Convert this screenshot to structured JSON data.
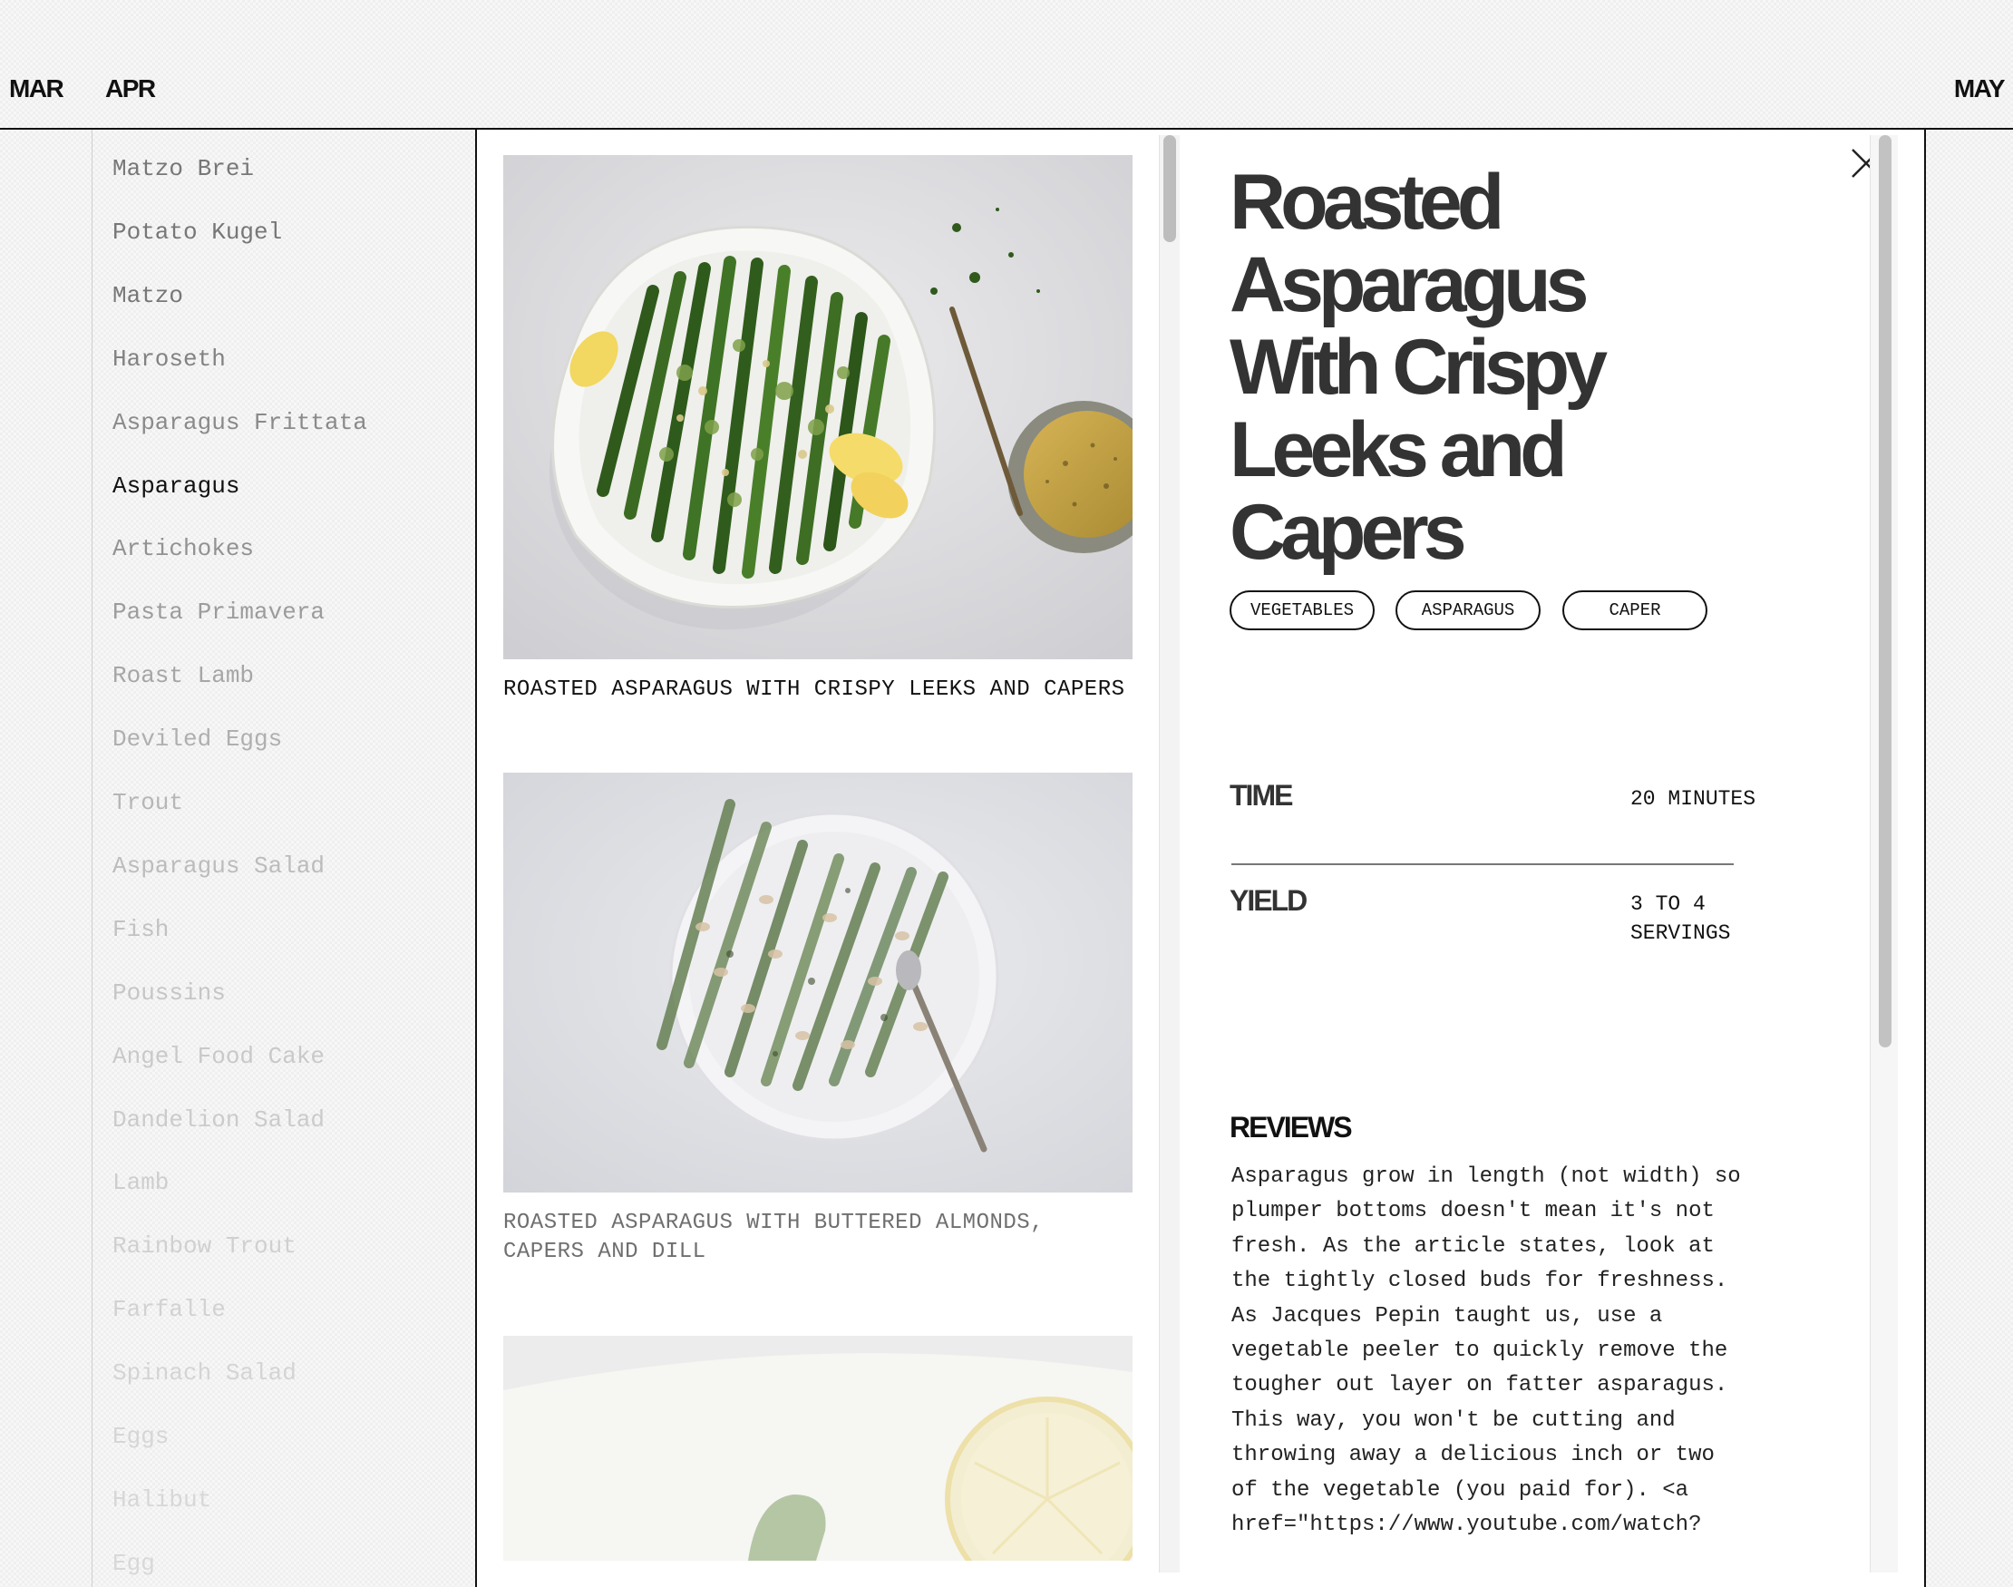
{
  "months": {
    "prev": "MAR",
    "current": "APR",
    "next": "MAY"
  },
  "sidebar": {
    "items": [
      {
        "label": "Matzo Brei",
        "color": "#777777"
      },
      {
        "label": "Potato Kugel",
        "color": "#777777"
      },
      {
        "label": "Matzo",
        "color": "#777777"
      },
      {
        "label": "Haroseth",
        "color": "#828282"
      },
      {
        "label": "Asparagus Frittata",
        "color": "#8a8a8a"
      },
      {
        "label": "Asparagus",
        "color": "#111111",
        "active": true
      },
      {
        "label": "Artichokes",
        "color": "#929292"
      },
      {
        "label": "Pasta Primavera",
        "color": "#9c9c9c"
      },
      {
        "label": "Roast Lamb",
        "color": "#a6a6a6"
      },
      {
        "label": "Deviled Eggs",
        "color": "#afafaf"
      },
      {
        "label": "Trout",
        "color": "#b6b6b6"
      },
      {
        "label": "Asparagus Salad",
        "color": "#bcbcbc"
      },
      {
        "label": "Fish",
        "color": "#c2c2c2"
      },
      {
        "label": "Poussins",
        "color": "#c6c6c6"
      },
      {
        "label": "Angel Food Cake",
        "color": "#c9c9c9"
      },
      {
        "label": "Dandelion Salad",
        "color": "#cbcbcb"
      },
      {
        "label": "Lamb",
        "color": "#cecece"
      },
      {
        "label": "Rainbow Trout",
        "color": "#d0d0d0"
      },
      {
        "label": "Farfalle",
        "color": "#d2d2d2"
      },
      {
        "label": "Spinach Salad",
        "color": "#d4d4d4"
      },
      {
        "label": "Eggs",
        "color": "#d6d6d6"
      },
      {
        "label": "Halibut",
        "color": "#d7d7d7"
      },
      {
        "label": "Egg",
        "color": "#d8d8d8"
      }
    ]
  },
  "recipes": [
    {
      "caption": "ROASTED ASPARAGUS WITH CRISPY LEEKS AND CAPERS",
      "caption_color": "#111111"
    },
    {
      "caption": "ROASTED ASPARAGUS WITH BUTTERED ALMONDS, CAPERS AND DILL",
      "caption_color": "#6f6f6f"
    }
  ],
  "detail": {
    "title": "Roasted Asparagus With Crispy Leeks and Capers",
    "tags": [
      "VEGETABLES",
      "ASPARAGUS",
      "CAPER"
    ],
    "time_label": "TIME",
    "time_value": "20 MINUTES",
    "yield_label": "YIELD",
    "yield_value": "3 TO 4 SERVINGS",
    "reviews_heading": "REVIEWS",
    "review_text": "Asparagus grow in length (not width) so plumper bottoms doesn't mean it's not fresh. As the article states, look at the tightly closed buds for freshness. As Jacques Pepin taught us, use a vegetable peeler to quickly remove the tougher out layer on fatter asparagus. This way, you won't be cutting and throwing away a delicious inch or two of the vegetable (you paid for). <a href=\"https://www.youtube.com/watch?"
  }
}
